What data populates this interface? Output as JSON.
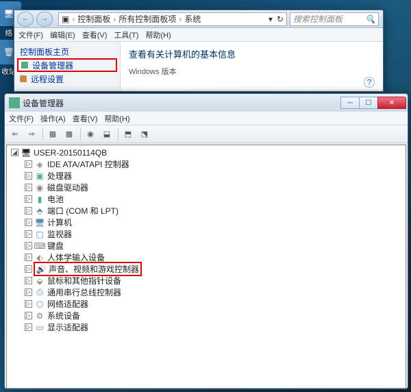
{
  "desktop": {
    "icons": [
      {
        "label": "络"
      },
      {
        "label": "收站"
      }
    ]
  },
  "cp_window": {
    "breadcrumbs": [
      "控制面板",
      "所有控制面板项",
      "系统"
    ],
    "search_placeholder": "搜索控制面板",
    "menu": [
      "文件(F)",
      "编辑(E)",
      "查看(V)",
      "工具(T)",
      "帮助(H)"
    ],
    "sidebar": {
      "heading": "控制面板主页",
      "device_mgr": "设备管理器",
      "remote": "远程设置"
    },
    "content": {
      "heading": "查看有关计算机的基本信息",
      "section": "Windows 版本"
    }
  },
  "dm_window": {
    "title": "设备管理器",
    "menu": [
      "文件(F)",
      "操作(A)",
      "查看(V)",
      "帮助(H)"
    ],
    "root": "USER-20150114QB",
    "devices": [
      {
        "label": "IDE ATA/ATAPI 控制器",
        "icon": "◈",
        "color": "#888"
      },
      {
        "label": "处理器",
        "icon": "▣",
        "color": "#5a8"
      },
      {
        "label": "磁盘驱动器",
        "icon": "◉",
        "color": "#888"
      },
      {
        "label": "电池",
        "icon": "▮",
        "color": "#5a8"
      },
      {
        "label": "端口 (COM 和 LPT)",
        "icon": "⬘",
        "color": "#58a"
      },
      {
        "label": "计算机",
        "icon": "🖥",
        "color": "#58a"
      },
      {
        "label": "监视器",
        "icon": "▢",
        "color": "#58a"
      },
      {
        "label": "键盘",
        "icon": "⌨",
        "color": "#888"
      },
      {
        "label": "人体学输入设备",
        "icon": "⬖",
        "color": "#888"
      },
      {
        "label": "声音、视频和游戏控制器",
        "icon": "🔊",
        "color": "#888",
        "highlight": true
      },
      {
        "label": "鼠标和其他指针设备",
        "icon": "⬙",
        "color": "#888"
      },
      {
        "label": "通用串行总线控制器",
        "icon": "⎙",
        "color": "#58a"
      },
      {
        "label": "网络适配器",
        "icon": "⬡",
        "color": "#58a"
      },
      {
        "label": "系统设备",
        "icon": "⚙",
        "color": "#888"
      },
      {
        "label": "显示适配器",
        "icon": "▭",
        "color": "#58a"
      }
    ]
  },
  "expander": {
    "collapsed": "▷",
    "expanded": "◢"
  },
  "winbtns": {
    "min": "─",
    "max": "☐",
    "close": "✕"
  },
  "nav": {
    "back": "←",
    "fwd": "→",
    "drop": "▾",
    "refresh": "↻",
    "search": "🔍",
    "help": "?"
  }
}
